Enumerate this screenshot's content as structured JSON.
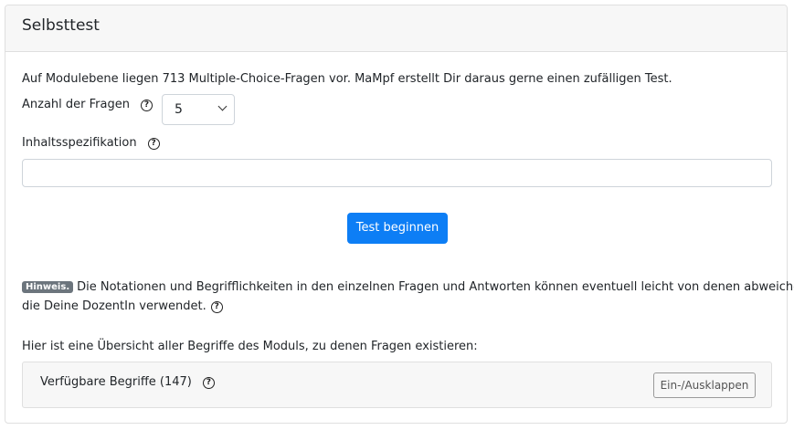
{
  "card": {
    "title": "Selbsttest"
  },
  "intro_text": "Auf Modulebene liegen 713 Multiple-Choice-Fragen vor. MaMpf erstellt Dir daraus gerne einen zufälligen Test.",
  "question_count": {
    "label": "Anzahl der Fragen",
    "selected_value": "5"
  },
  "content_spec": {
    "label": "Inhaltsspezifikation",
    "value": ""
  },
  "start_button": {
    "label": "Test beginnen"
  },
  "note": {
    "badge": "Hinweis.",
    "text_line1": "Die Notationen und Begrifflichkeiten in den einzelnen Fragen und Antworten können eventuell leicht von denen abweichen,",
    "text_line2": "die Deine DozentIn verwendet."
  },
  "overview_text": "Hier ist eine Übersicht aller Begriffe des Moduls, zu denen Fragen existieren:",
  "terms_panel": {
    "label": "Verfügbare Begriffe (147)",
    "toggle_label": "Ein-/Ausklappen"
  },
  "icons": {
    "help": "question-circle-icon",
    "dropdown": "chevron-down-icon"
  },
  "colors": {
    "primary": "#0d7ef5",
    "badge": "#6c757d",
    "header_bg": "#f7f7f7"
  }
}
